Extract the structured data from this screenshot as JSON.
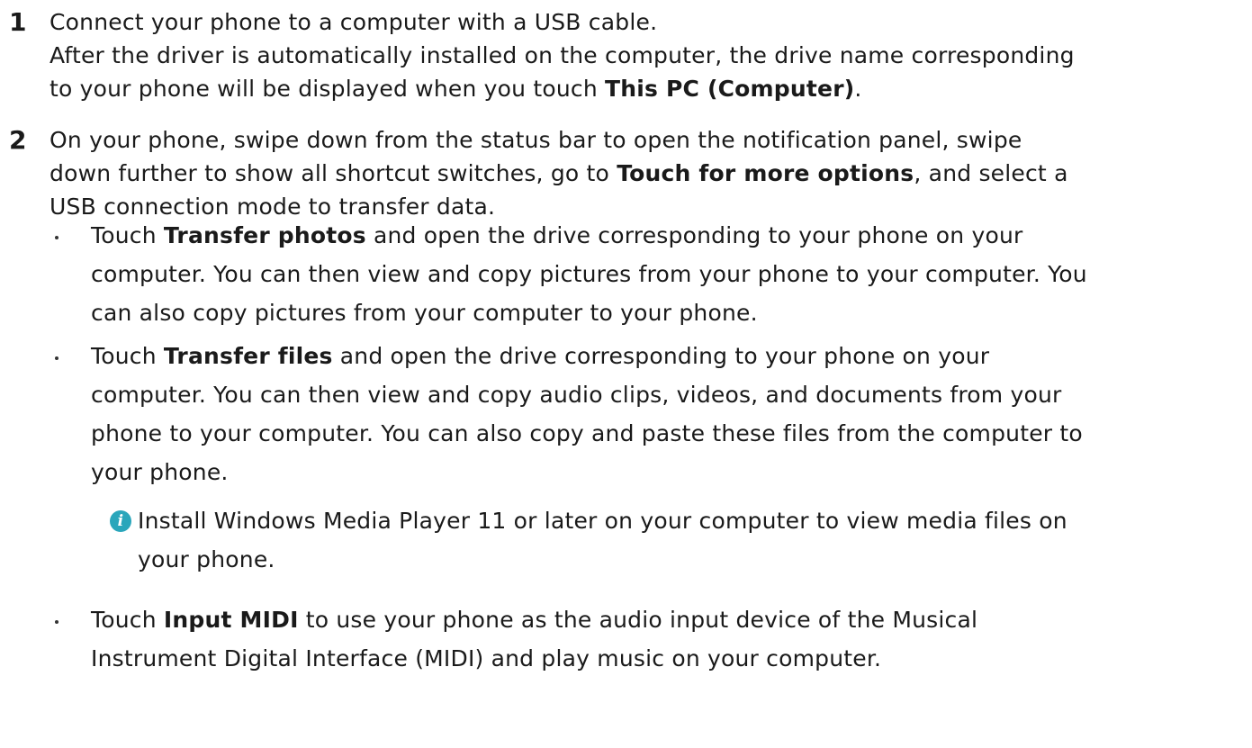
{
  "step1": {
    "number": "1",
    "line1": "Connect your phone to a computer with a USB cable.",
    "line2": "After the driver is automatically installed on the computer, the drive name corresponding",
    "line3_pre": "to your phone will be displayed when you touch ",
    "line3_bold": "This PC (Computer)",
    "line3_post": "."
  },
  "step2": {
    "number": "2",
    "line1": "On your phone, swipe down from the status bar to open the notification panel, swipe",
    "line2_pre": "down further to show all shortcut switches, go to ",
    "line2_bold": "Touch for more options",
    "line2_post": ", and select a",
    "line3": "USB connection mode to transfer data."
  },
  "bullets": [
    {
      "pre": "Touch ",
      "bold": "Transfer photos",
      "post": " and open the drive corresponding to your phone on your",
      "lines": [
        "computer. You can then view and copy pictures from your phone to your computer. You",
        "can also copy pictures from your computer to your phone."
      ]
    },
    {
      "pre": "Touch ",
      "bold": "Transfer files",
      "post": " and open the drive corresponding to your phone on your",
      "lines": [
        "computer. You can then view and copy audio clips, videos, and documents from your",
        "phone to your computer. You can also copy and paste these files from the computer to",
        "your phone."
      ]
    },
    {
      "pre": "Touch ",
      "bold": "Input MIDI",
      "post": " to use your phone as the audio input device of the Musical",
      "lines": [
        "Instrument Digital Interface (MIDI) and play music on your computer."
      ]
    }
  ],
  "note": {
    "icon": "info-icon",
    "icon_glyph": "i",
    "icon_color": "#2aa6bb",
    "line1": "Install Windows Media Player 11 or later on your computer to view media files on",
    "line2": "your phone."
  }
}
